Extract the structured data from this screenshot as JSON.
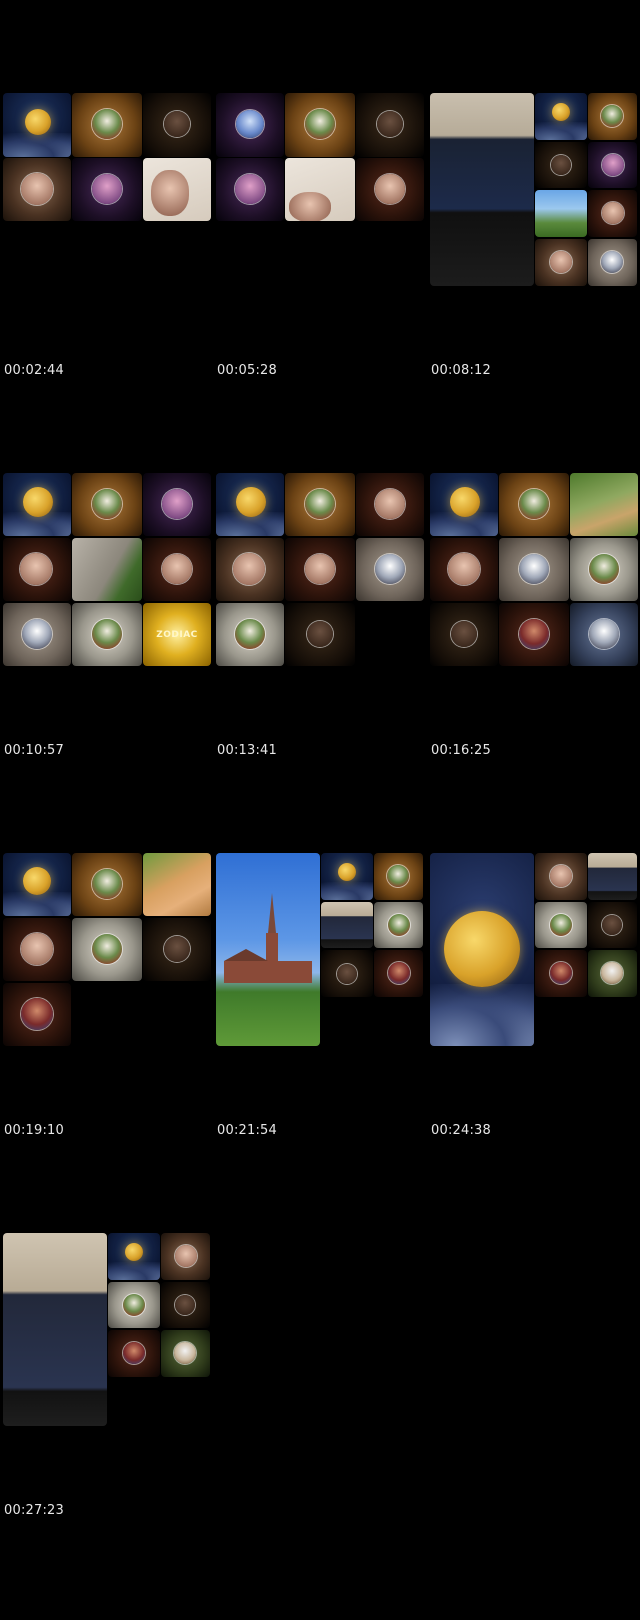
{
  "thumbnails": [
    {
      "timestamp": "00:02:44"
    },
    {
      "timestamp": "00:05:28"
    },
    {
      "timestamp": "00:08:12"
    },
    {
      "timestamp": "00:10:57"
    },
    {
      "timestamp": "00:13:41"
    },
    {
      "timestamp": "00:16:25"
    },
    {
      "timestamp": "00:19:10"
    },
    {
      "timestamp": "00:21:54"
    },
    {
      "timestamp": "00:24:38"
    },
    {
      "timestamp": "00:27:23"
    }
  ],
  "tile_labels": {
    "zodiac_text": "ZODIAC"
  },
  "colors": {
    "background": "#000000",
    "timestamp_text": "#e8e8e8"
  }
}
